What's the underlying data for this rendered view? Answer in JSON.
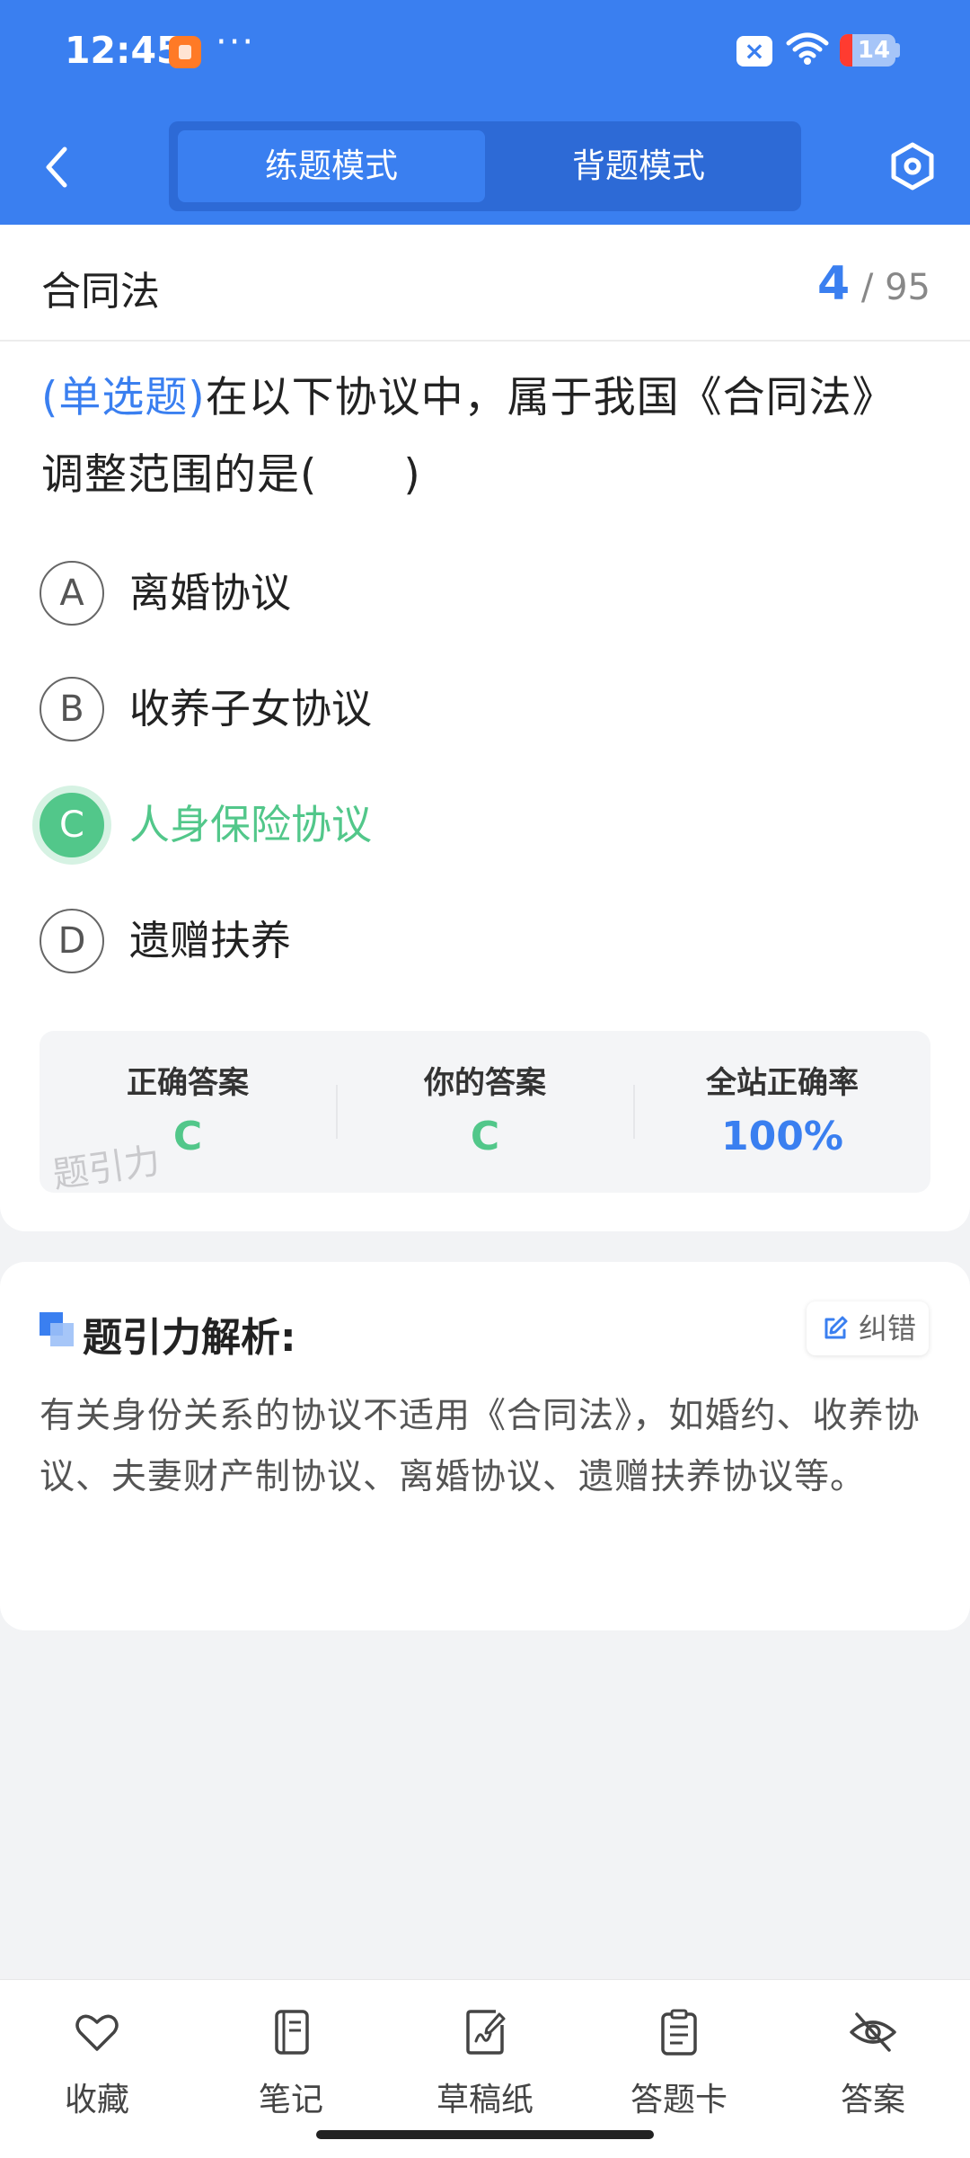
{
  "status_bar": {
    "time": "12:45",
    "dots": "···",
    "battery": "14"
  },
  "header": {
    "tabs": [
      {
        "label": "练题模式",
        "active": true
      },
      {
        "label": "背题模式",
        "active": false
      }
    ]
  },
  "question_card": {
    "chapter": "合同法",
    "progress_current": "4",
    "progress_sep": "/",
    "progress_total": "95",
    "question_type": "(单选题)",
    "question_text": "在以下协议中，属于我国《合同法》调整范围的是(　　)",
    "options": [
      {
        "letter": "A",
        "text": "离婚协议"
      },
      {
        "letter": "B",
        "text": "收养子女协议"
      },
      {
        "letter": "C",
        "text": "人身保险协议",
        "correct": true
      },
      {
        "letter": "D",
        "text": "遗赠扶养"
      }
    ],
    "answer_box": {
      "correct_label": "正确答案",
      "correct_value": "C",
      "yours_label": "你的答案",
      "yours_value": "C",
      "rate_label": "全站正确率",
      "rate_value": "100%",
      "watermark": "题引力"
    }
  },
  "analysis": {
    "title": "题引力解析:",
    "report_label": "纠错",
    "text": "有关身份关系的协议不适用《合同法》，如婚约、收养协议、夫妻财产制协议、离婚协议、遗赠扶养协议等。"
  },
  "bottom_nav": [
    {
      "label": "收藏",
      "icon": "heart-icon"
    },
    {
      "label": "笔记",
      "icon": "notebook-icon"
    },
    {
      "label": "草稿纸",
      "icon": "draft-paper-icon"
    },
    {
      "label": "答题卡",
      "icon": "answer-card-icon"
    },
    {
      "label": "答案",
      "icon": "eye-off-icon"
    }
  ],
  "colors": {
    "primary": "#3a7ff0",
    "correct": "#52c78a",
    "background": "#f2f3f5"
  }
}
